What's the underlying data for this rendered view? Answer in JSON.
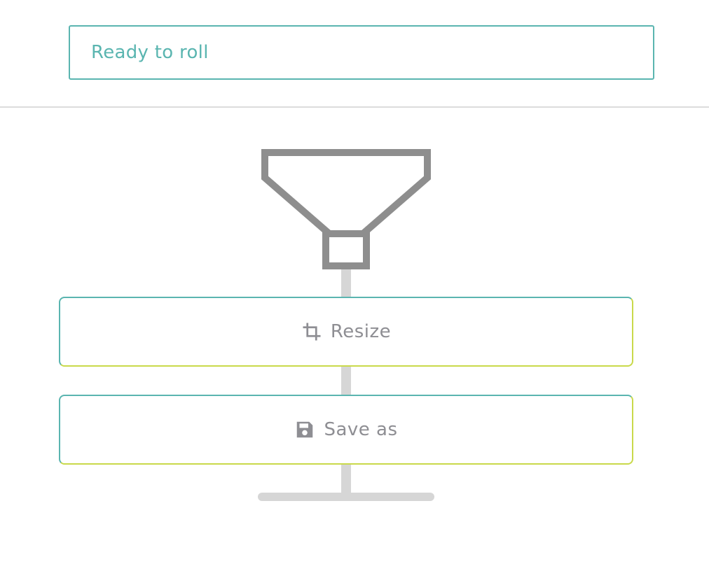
{
  "status": {
    "text": "Ready to roll"
  },
  "pipeline": {
    "input_icon": "funnel-icon",
    "steps": [
      {
        "label": "Resize",
        "icon": "crop-icon"
      },
      {
        "label": "Save as",
        "icon": "floppy-disk-icon"
      }
    ],
    "end_icon": "end-bar"
  },
  "colors": {
    "accent": "#5ab5b0",
    "accent_secondary": "#c9d94a",
    "text_muted": "#8e8e93",
    "connector": "#d6d6d6",
    "icon_gray": "#8e8e8e"
  }
}
